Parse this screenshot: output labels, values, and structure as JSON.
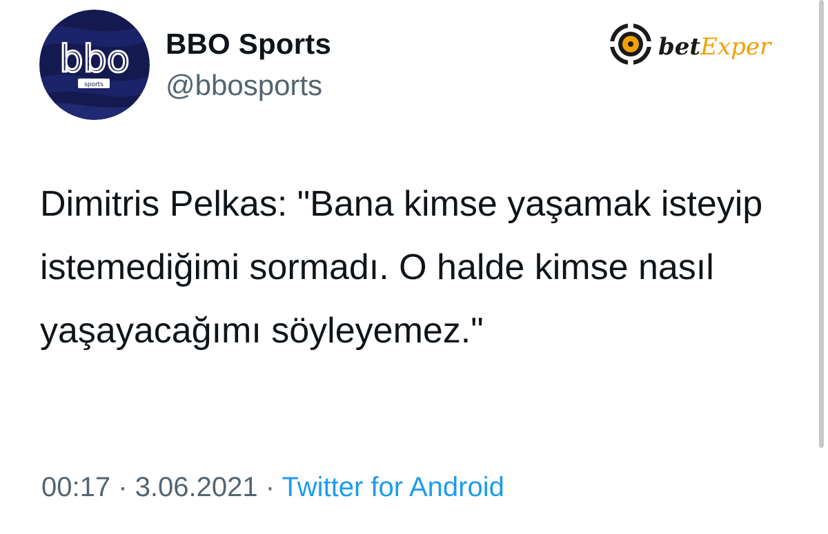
{
  "author": {
    "display_name": "BBO Sports",
    "handle": "@bbosports",
    "avatar_text": "bbo",
    "avatar_subtext": "sports"
  },
  "sponsor": {
    "logo_icon": "poker-chip-icon",
    "text_part1": "bet",
    "text_part2": "Exper"
  },
  "tweet": {
    "text": "Dimitris Pelkas: \"Bana kimse yaşamak isteyip istemediğimi sormadı. O halde kimse nasıl yaşayacağımı söyleyemez.\""
  },
  "meta": {
    "time": "00:17",
    "separator": "·",
    "date": "3.06.2021",
    "source": "Twitter for Android"
  },
  "colors": {
    "avatar_bg": "#14194f",
    "text_primary": "#0f1419",
    "text_secondary": "#536471",
    "link": "#1d9bf0",
    "sponsor_accent": "#f0a000"
  }
}
